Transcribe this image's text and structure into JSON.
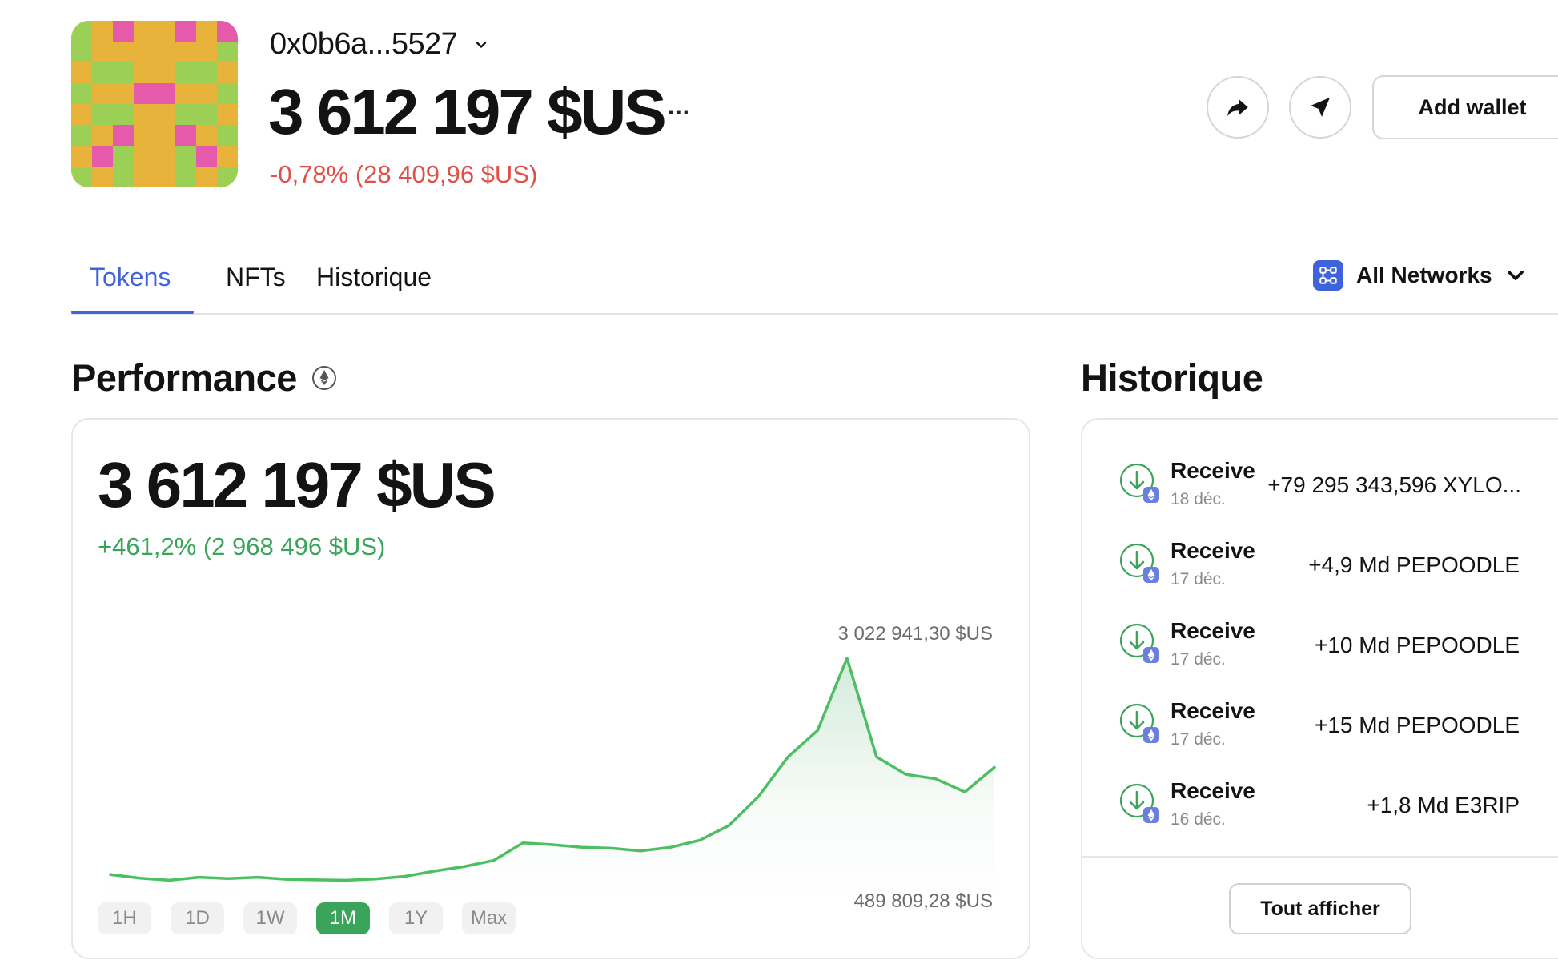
{
  "wallet": {
    "address": "0x0b6a...5527",
    "balance": "3 612 197 $US",
    "more_label": "...",
    "change": "-0,78% (28 409,96 $US)",
    "add_wallet_label": "Add wallet"
  },
  "tabs": [
    {
      "label": "Tokens",
      "active": true
    },
    {
      "label": "NFTs",
      "active": false
    },
    {
      "label": "Historique",
      "active": false
    }
  ],
  "network_selector": {
    "label": "All Networks"
  },
  "performance": {
    "title": "Performance",
    "value": "3 612 197 $US",
    "change": "+461,2% (2 968 496 $US)",
    "high_label": "3 022 941,30 $US",
    "low_label": "489 809,28 $US",
    "ranges": [
      "1H",
      "1D",
      "1W",
      "1M",
      "1Y",
      "Max"
    ],
    "active_range": "1M"
  },
  "history": {
    "title": "Historique",
    "items": [
      {
        "type": "Receive",
        "date": "18 déc.",
        "amount": "+79 295 343,596 XYLO..."
      },
      {
        "type": "Receive",
        "date": "17 déc.",
        "amount": "+4,9 Md PEPOODLE"
      },
      {
        "type": "Receive",
        "date": "17 déc.",
        "amount": "+10 Md PEPOODLE"
      },
      {
        "type": "Receive",
        "date": "17 déc.",
        "amount": "+15 Md PEPOODLE"
      },
      {
        "type": "Receive",
        "date": "16 déc.",
        "amount": "+1,8 Md E3RIP"
      }
    ],
    "show_all_label": "Tout afficher"
  },
  "colors": {
    "accent": "#3e63dd",
    "positive": "#3aa55a",
    "negative": "#e0504a"
  },
  "chart_data": {
    "type": "area",
    "x": [
      0,
      1,
      2,
      3,
      4,
      5,
      6,
      7,
      8,
      9,
      10,
      11,
      12,
      13,
      14,
      15,
      16,
      17,
      18,
      19,
      20,
      21,
      22,
      23,
      24,
      25,
      26,
      27,
      28,
      29,
      30
    ],
    "values": [
      560000,
      520000,
      495000,
      530000,
      515000,
      530000,
      505000,
      500000,
      495000,
      510000,
      540000,
      600000,
      650000,
      720000,
      920000,
      900000,
      870000,
      860000,
      830000,
      870000,
      950000,
      1120000,
      1450000,
      1900000,
      2200000,
      3022941.3,
      1900000,
      1700000,
      1650000,
      1500000,
      1780000
    ],
    "ylim": [
      489809.28,
      3022941.3
    ]
  }
}
